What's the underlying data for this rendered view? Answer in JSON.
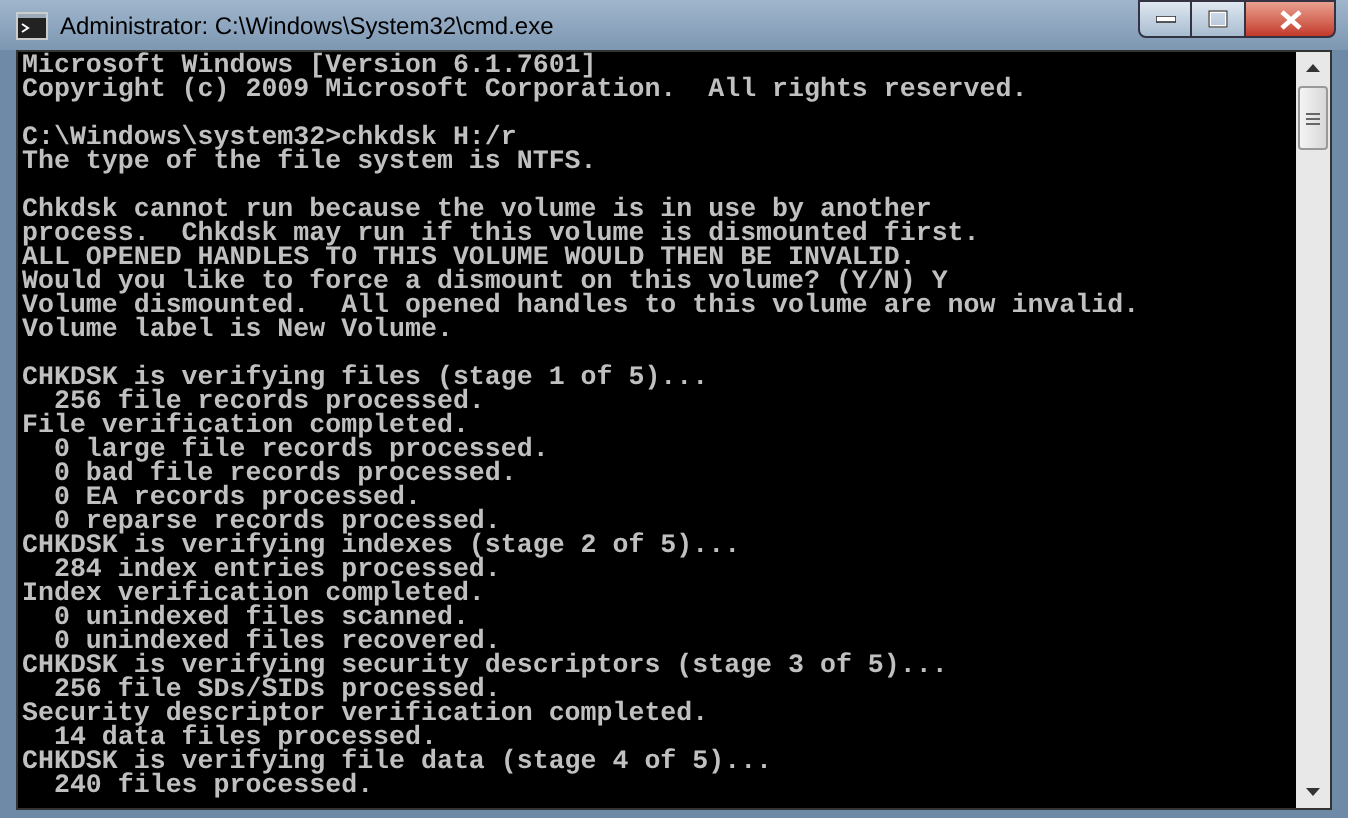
{
  "window": {
    "title": "Administrator: C:\\Windows\\System32\\cmd.exe"
  },
  "console": {
    "blocks": [
      {
        "lines": [
          "Microsoft Windows [Version 6.1.7601]",
          "Copyright (c) 2009 Microsoft Corporation.  All rights reserved."
        ]
      },
      {
        "lines": [
          "C:\\Windows\\system32>chkdsk H:/r",
          "The type of the file system is NTFS."
        ]
      },
      {
        "lines": [
          "Chkdsk cannot run because the volume is in use by another",
          "process.  Chkdsk may run if this volume is dismounted first.",
          "ALL OPENED HANDLES TO THIS VOLUME WOULD THEN BE INVALID.",
          "Would you like to force a dismount on this volume? (Y/N) Y",
          "Volume dismounted.  All opened handles to this volume are now invalid.",
          "Volume label is New Volume."
        ]
      },
      {
        "lines": [
          "CHKDSK is verifying files (stage 1 of 5)...",
          "  256 file records processed.",
          "File verification completed.",
          "  0 large file records processed.",
          "  0 bad file records processed.",
          "  0 EA records processed.",
          "  0 reparse records processed.",
          "CHKDSK is verifying indexes (stage 2 of 5)...",
          "  284 index entries processed.",
          "Index verification completed.",
          "  0 unindexed files scanned.",
          "  0 unindexed files recovered.",
          "CHKDSK is verifying security descriptors (stage 3 of 5)...",
          "  256 file SDs/SIDs processed.",
          "Security descriptor verification completed.",
          "  14 data files processed.",
          "CHKDSK is verifying file data (stage 4 of 5)...",
          "  240 files processed."
        ]
      }
    ]
  }
}
